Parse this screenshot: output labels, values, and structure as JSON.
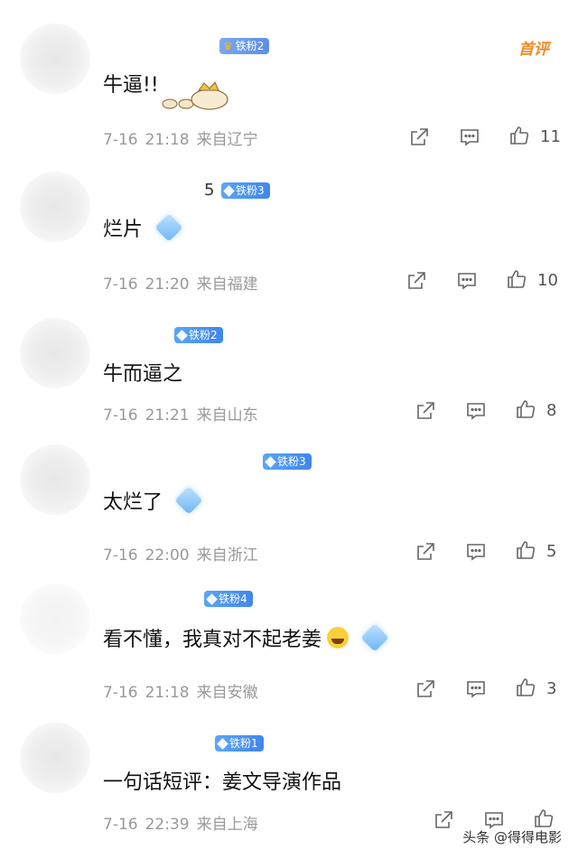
{
  "top_label": "首评",
  "comments": [
    {
      "badge": "铁粉2",
      "name_fragment": "",
      "text": "牛逼!!",
      "date": "7-16",
      "time": "21:18",
      "location": "来自辽宁",
      "likes": "11"
    },
    {
      "badge": "铁粉3",
      "name_fragment": "5",
      "text": "烂片",
      "date": "7-16",
      "time": "21:20",
      "location": "来自福建",
      "likes": "10"
    },
    {
      "badge": "铁粉2",
      "name_fragment": "",
      "text": "牛而逼之",
      "date": "7-16",
      "time": "21:21",
      "location": "来自山东",
      "likes": "8"
    },
    {
      "badge": "铁粉3",
      "name_fragment": "",
      "text": "太烂了",
      "date": "7-16",
      "time": "22:00",
      "location": "来自浙江",
      "likes": "5"
    },
    {
      "badge": "铁粉4",
      "name_fragment": "",
      "text": "看不懂，我真对不起老姜",
      "date": "7-16",
      "time": "21:18",
      "location": "来自安徽",
      "likes": "3"
    },
    {
      "badge": "铁粉1",
      "name_fragment": "",
      "text": "一句话短评：姜文导演作品",
      "date": "7-16",
      "time": "22:39",
      "location": "来自上海",
      "likes": ""
    }
  ],
  "watermark": "头条 @得得电影",
  "icons": {
    "share": "share-icon",
    "reply": "reply-icon",
    "like": "like-icon"
  }
}
